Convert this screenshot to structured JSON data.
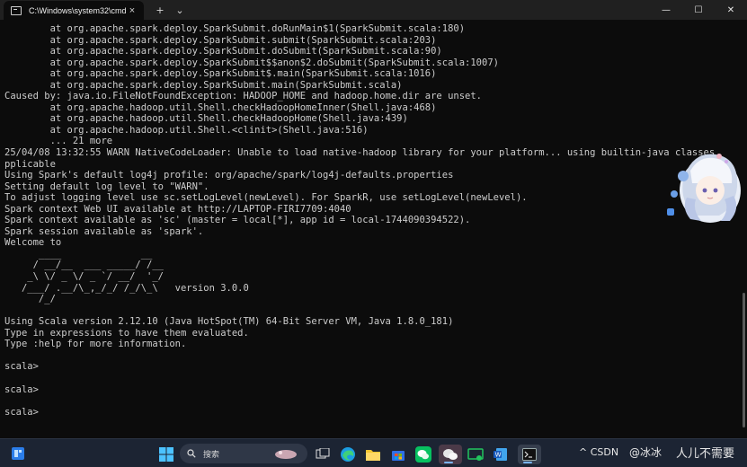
{
  "window": {
    "tab_title": "C:\\Windows\\system32\\cmd.e",
    "tab_close": "×",
    "new_tab": "+",
    "dropdown": "⌄",
    "minimize": "—",
    "maximize": "☐",
    "close": "✕"
  },
  "console": {
    "lines": [
      "        at org.apache.spark.deploy.SparkSubmit.doRunMain$1(SparkSubmit.scala:180)",
      "        at org.apache.spark.deploy.SparkSubmit.submit(SparkSubmit.scala:203)",
      "        at org.apache.spark.deploy.SparkSubmit.doSubmit(SparkSubmit.scala:90)",
      "        at org.apache.spark.deploy.SparkSubmit$$anon$2.doSubmit(SparkSubmit.scala:1007)",
      "        at org.apache.spark.deploy.SparkSubmit$.main(SparkSubmit.scala:1016)",
      "        at org.apache.spark.deploy.SparkSubmit.main(SparkSubmit.scala)",
      "Caused by: java.io.FileNotFoundException: HADOOP_HOME and hadoop.home.dir are unset.",
      "        at org.apache.hadoop.util.Shell.checkHadoopHomeInner(Shell.java:468)",
      "        at org.apache.hadoop.util.Shell.checkHadoopHome(Shell.java:439)",
      "        at org.apache.hadoop.util.Shell.<clinit>(Shell.java:516)",
      "        ... 21 more",
      "25/04/08 13:32:55 WARN NativeCodeLoader: Unable to load native-hadoop library for your platform... using builtin-java classes",
      "pplicable",
      "Using Spark's default log4j profile: org/apache/spark/log4j-defaults.properties",
      "Setting default log level to \"WARN\".",
      "To adjust logging level use sc.setLogLevel(newLevel). For SparkR, use setLogLevel(newLevel).",
      "Spark context Web UI available at http://LAPTOP-FIRI7709:4040",
      "Spark context available as 'sc' (master = local[*], app id = local-1744090394522).",
      "Spark session available as 'spark'.",
      "Welcome to",
      "      ____              __",
      "     / __/__  ___ _____/ /__",
      "    _\\ \\/ _ \\/ _ `/ __/  '_/",
      "   /___/ .__/\\_,_/_/ /_/\\_\\   version 3.0.0",
      "      /_/",
      "",
      "Using Scala version 2.12.10 (Java HotSpot(TM) 64-Bit Server VM, Java 1.8.0_181)",
      "Type in expressions to have them evaluated.",
      "Type :help for more information.",
      "",
      "scala>",
      "",
      "scala>",
      "",
      "scala>"
    ]
  },
  "taskbar": {
    "search_placeholder": "搜索",
    "tray_text": "^ CSDN",
    "watermark": "@冰冰",
    "watermark2": "人儿不需要"
  },
  "colors": {
    "console_bg": "#0c0c0c",
    "console_text": "#cccccc",
    "titlebar_bg": "#202020",
    "taskbar_bg": "#1c2433"
  }
}
